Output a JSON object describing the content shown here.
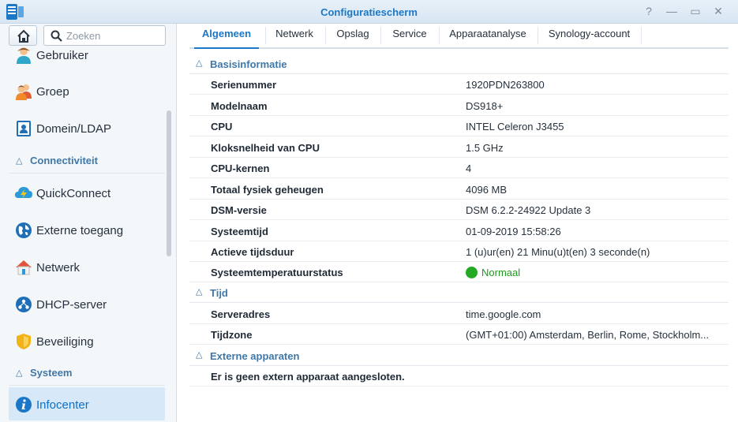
{
  "window": {
    "title": "Configuratiescherm",
    "buttons": {
      "help": "?",
      "minimize": "—",
      "maximize": "▭",
      "close": "✕"
    }
  },
  "sidebar": {
    "search_placeholder": "Zoeken",
    "items_top": [
      {
        "label": "Gebruiker",
        "icon": "user-icon"
      },
      {
        "label": "Groep",
        "icon": "group-icon"
      },
      {
        "label": "Domein/LDAP",
        "icon": "domain-ldap-icon"
      }
    ],
    "section_connectivity": "Connectiviteit",
    "items_connectivity": [
      {
        "label": "QuickConnect",
        "icon": "quickconnect-icon"
      },
      {
        "label": "Externe toegang",
        "icon": "external-access-icon"
      },
      {
        "label": "Netwerk",
        "icon": "network-icon"
      },
      {
        "label": "DHCP-server",
        "icon": "dhcp-server-icon"
      },
      {
        "label": "Beveiliging",
        "icon": "security-shield-icon"
      }
    ],
    "section_system": "Systeem",
    "items_system": [
      {
        "label": "Infocenter",
        "icon": "info-icon",
        "active": true
      }
    ]
  },
  "tabs": [
    "Algemeen",
    "Netwerk",
    "Opslag",
    "Service",
    "Apparaatanalyse",
    "Synology-account"
  ],
  "active_tab": "Algemeen",
  "groups": {
    "basic": {
      "title": "Basisinformatie",
      "rows": [
        {
          "key": "Serienummer",
          "value": "1920PDN263800"
        },
        {
          "key": "Modelnaam",
          "value": "DS918+"
        },
        {
          "key": "CPU",
          "value": "INTEL Celeron J3455"
        },
        {
          "key": "Kloksnelheid van CPU",
          "value": "1.5 GHz"
        },
        {
          "key": "CPU-kernen",
          "value": "4"
        },
        {
          "key": "Totaal fysiek geheugen",
          "value": "4096 MB"
        },
        {
          "key": "DSM-versie",
          "value": "DSM 6.2.2-24922 Update 3"
        },
        {
          "key": "Systeemtijd",
          "value": "01-09-2019 15:58:26"
        },
        {
          "key": "Actieve tijdsduur",
          "value": "1 (u)ur(en) 21 Minu(u)t(en) 3 seconde(n)"
        },
        {
          "key": "Systeemtemperatuurstatus",
          "value": "Normaal",
          "status_color": "#24a924"
        }
      ]
    },
    "time": {
      "title": "Tijd",
      "rows": [
        {
          "key": "Serveradres",
          "value": "time.google.com"
        },
        {
          "key": "Tijdzone",
          "value": "(GMT+01:00) Amsterdam, Berlin, Rome, Stockholm..."
        }
      ]
    },
    "external": {
      "title": "Externe apparaten",
      "message": "Er is geen extern apparaat aangesloten."
    }
  },
  "colors": {
    "accent": "#1b78c8",
    "section": "#3f78a8",
    "active_bg": "#d7e9f8",
    "ok": "#24a924"
  }
}
